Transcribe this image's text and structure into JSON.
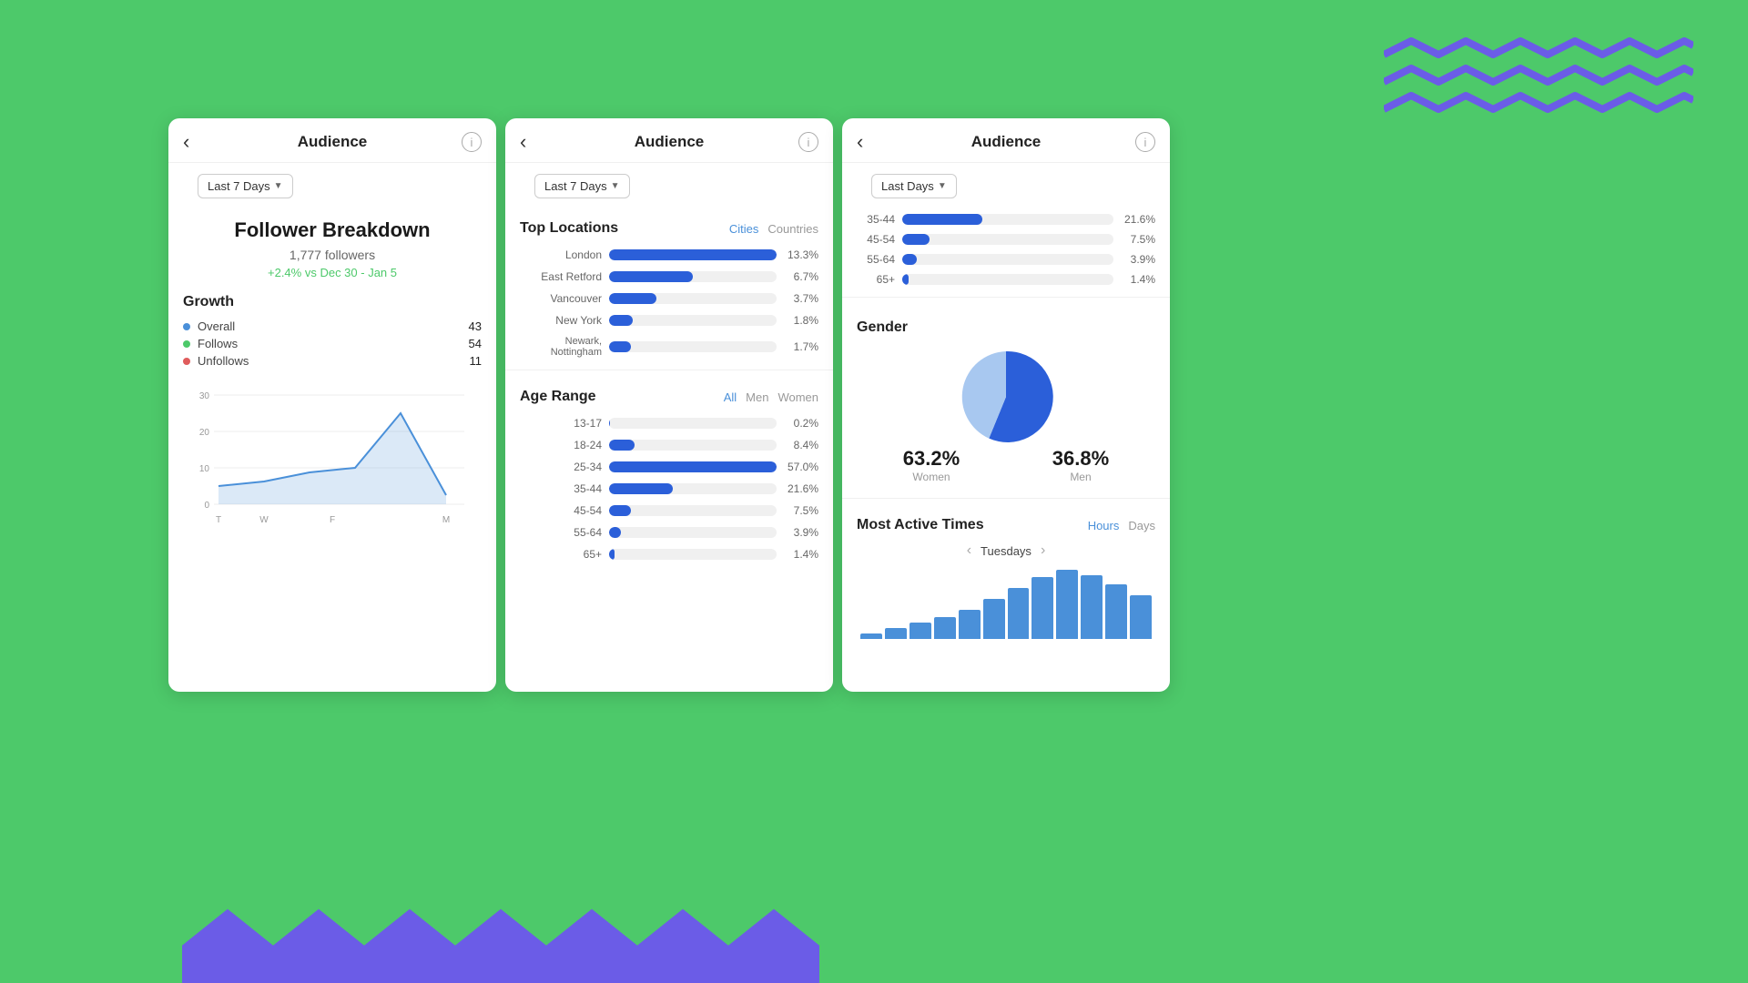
{
  "bg_color": "#4DC96A",
  "decoration": {
    "zigzag_color_purple": "#6B5CE7",
    "zigzag_color_purple2": "#6B5CE7"
  },
  "panel1": {
    "title": "Audience",
    "date_filter": "Last 7 Days",
    "breakdown_title": "Follower Breakdown",
    "follower_count": "1,777 followers",
    "follower_change": "+2.4% vs Dec 30 - Jan 5",
    "growth_label": "Growth",
    "legend": [
      {
        "label": "Overall",
        "color": "#4A90D9",
        "value": "43"
      },
      {
        "label": "Follows",
        "color": "#4DC96A",
        "value": "54"
      },
      {
        "label": "Unfollows",
        "color": "#E05C5C",
        "value": "11"
      }
    ],
    "chart_y": [
      "30",
      "20",
      "10",
      "0"
    ],
    "chart_x": [
      "T",
      "W",
      "F",
      "M"
    ]
  },
  "panel2": {
    "title": "Audience",
    "date_filter": "Last 7 Days",
    "top_locations_label": "Top Locations",
    "toggle_cities": "Cities",
    "toggle_countries": "Countries",
    "locations": [
      {
        "name": "London",
        "pct": 13.3,
        "label": "13.3%"
      },
      {
        "name": "East Retford",
        "pct": 6.7,
        "label": "6.7%"
      },
      {
        "name": "Vancouver",
        "pct": 3.7,
        "label": "3.7%"
      },
      {
        "name": "New York",
        "pct": 1.8,
        "label": "1.8%"
      },
      {
        "name": "Newark, Nottingham",
        "pct": 1.7,
        "label": "1.7%"
      }
    ],
    "age_range_label": "Age Range",
    "toggle_all": "All",
    "toggle_men": "Men",
    "toggle_women": "Women",
    "age_ranges": [
      {
        "label": "13-17",
        "pct": 0.2,
        "display": "0.2%"
      },
      {
        "label": "18-24",
        "pct": 8.4,
        "display": "8.4%"
      },
      {
        "label": "25-34",
        "pct": 57.0,
        "display": "57.0%"
      },
      {
        "label": "35-44",
        "pct": 21.6,
        "display": "21.6%"
      },
      {
        "label": "45-54",
        "pct": 7.5,
        "display": "7.5%"
      },
      {
        "label": "55-64",
        "pct": 3.9,
        "display": "3.9%"
      },
      {
        "label": "65+",
        "pct": 1.4,
        "display": "1.4%"
      }
    ]
  },
  "panel3": {
    "title": "Audience",
    "date_filter": "Last Days",
    "age_ranges": [
      {
        "label": "35-44",
        "pct": 21.6,
        "display": "21.6%"
      },
      {
        "label": "45-54",
        "pct": 7.5,
        "display": "7.5%"
      },
      {
        "label": "55-64",
        "pct": 3.9,
        "display": "3.9%"
      },
      {
        "label": "65+",
        "pct": 1.4,
        "display": "1.4%"
      }
    ],
    "gender_label": "Gender",
    "women_pct": "63.2%",
    "women_label": "Women",
    "men_pct": "36.8%",
    "men_label": "Men",
    "most_active_label": "Most Active Times",
    "toggle_hours": "Hours",
    "toggle_days": "Days",
    "day_nav_prev": "‹",
    "day_nav_day": "Tuesdays",
    "day_nav_next": "›",
    "hours_bars": [
      5,
      10,
      15,
      25,
      35,
      45,
      55,
      65,
      70,
      68,
      60,
      50
    ]
  }
}
